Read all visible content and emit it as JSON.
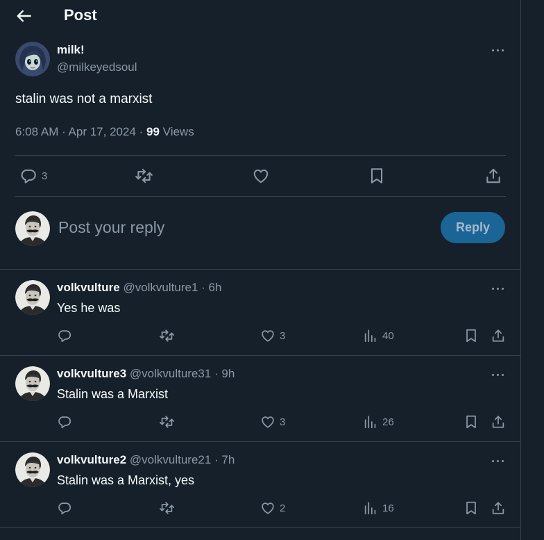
{
  "header": {
    "title": "Post"
  },
  "post": {
    "author_name": "milk!",
    "author_handle": "@milkeyedsoul",
    "text": "stalin was not a marxist",
    "meta_time": "6:08 AM · Apr 17, 2024 · ",
    "views_count": "99",
    "views_label": " Views",
    "reply_count": "3"
  },
  "composer": {
    "placeholder": "Post your reply",
    "button_label": "Reply"
  },
  "replies": [
    {
      "name": "volkvulture",
      "handle": "@volkvulture1 · 6h",
      "text": "Yes he was",
      "likes": "3",
      "views": "40"
    },
    {
      "name": "volkvulture3",
      "handle": "@volkvulture31 · 9h",
      "text": "Stalin was a Marxist",
      "likes": "3",
      "views": "26"
    },
    {
      "name": "volkvulture2",
      "handle": "@volkvulture21 · 7h",
      "text": "Stalin was a Marxist, yes",
      "likes": "2",
      "views": "16"
    }
  ],
  "colors": {
    "background": "#15202b",
    "border": "#38444d",
    "muted": "#8b98a5",
    "reply_button": "#1a6496"
  }
}
